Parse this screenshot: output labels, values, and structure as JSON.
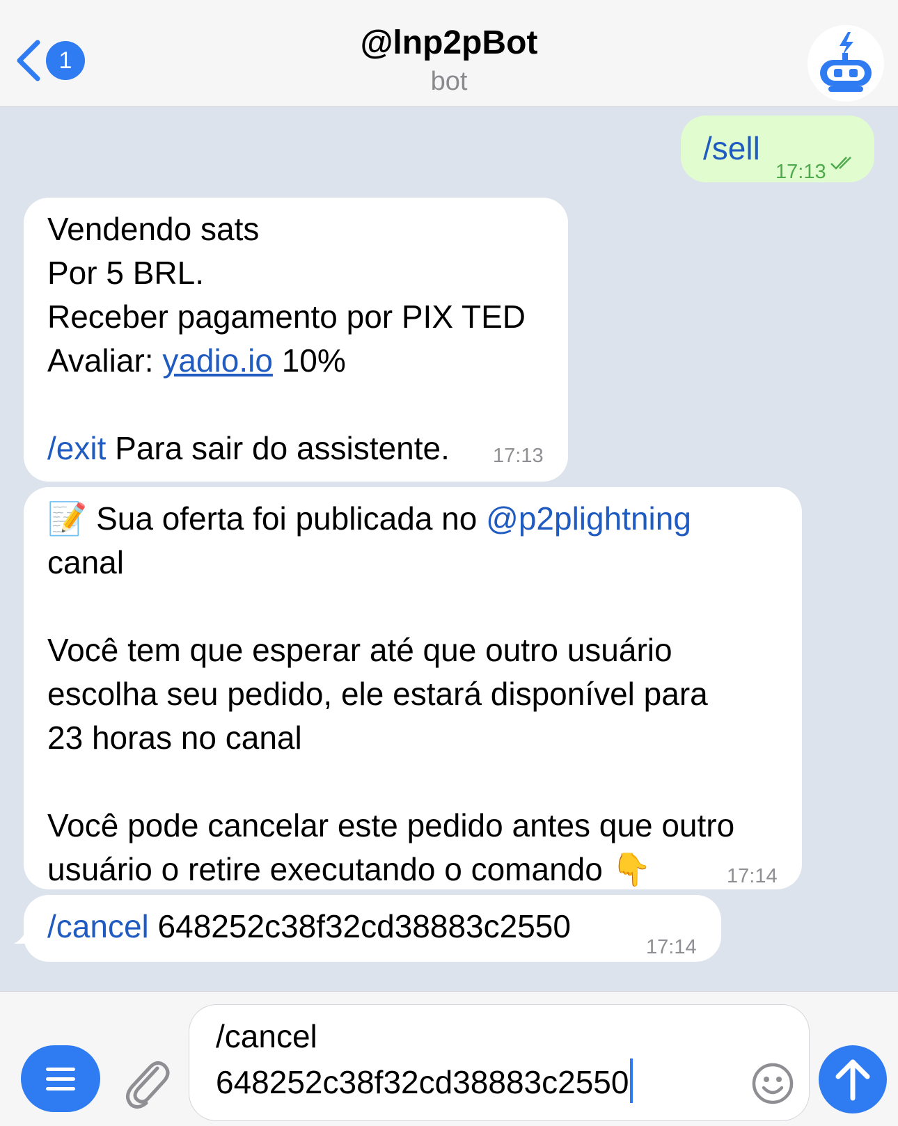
{
  "header": {
    "back_badge": "1",
    "title": "@lnp2pBot",
    "subtitle": "bot"
  },
  "messages": [
    {
      "text": "/sell",
      "time": "17:13"
    },
    {
      "line1": "Vendendo sats",
      "line2": "Por 5 BRL.",
      "line3": "Receber pagamento por PIX TED",
      "line4_prefix": "Avaliar:",
      "line4_link": "yadio.io",
      "line4_suffix": "10%",
      "exit_cmd": "/exit",
      "exit_text": "Para sair do assistente.",
      "time": "17:13"
    },
    {
      "emoji": "📝",
      "p1_text": "Sua oferta foi publicada no",
      "p1_mention": "@p2plightning",
      "p1_tail": "canal",
      "p2": "Você tem que esperar até que outro usuário escolha seu pedido, ele estará disponível para 23 horas no canal",
      "p3": "Você pode cancelar este pedido antes que outro usuário o retire executando o comando",
      "p3_emoji": "👇",
      "time": "17:14"
    },
    {
      "cmd": "/cancel",
      "id": "648252c38f32cd38883c2550",
      "time": "17:14"
    }
  ],
  "input": {
    "line1": "/cancel",
    "line2": "648252c38f32cd38883c2550"
  },
  "colors": {
    "accent": "#2f7bf1",
    "outgoing_bubble": "#e1fdcf",
    "chat_bg": "#dce3ed",
    "link": "#1f5bc0"
  },
  "icons": [
    "back-chevron-icon",
    "bot-avatar-icon",
    "double-check-icon",
    "menu-icon",
    "paperclip-icon",
    "emoji-icon",
    "send-arrow-icon"
  ]
}
